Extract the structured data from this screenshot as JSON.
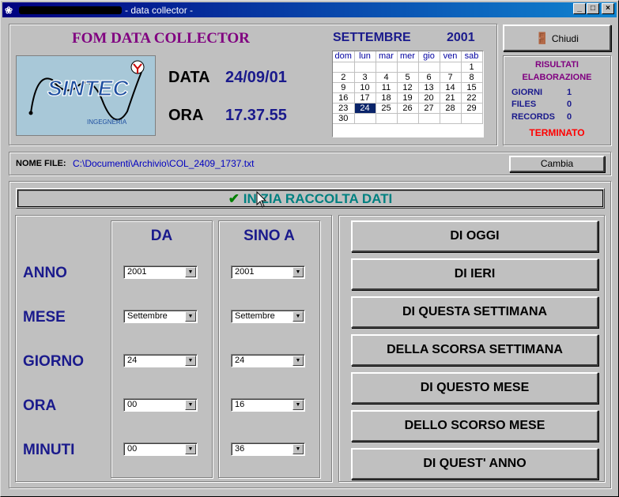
{
  "window": {
    "app_name_obscured": true,
    "title": "- data collector -"
  },
  "header": {
    "app_title": "FOM DATA COLLECTOR",
    "data_label": "DATA",
    "data_value": "24/09/01",
    "ora_label": "ORA",
    "ora_value": "17.37.55"
  },
  "logo": {
    "brand": "SINTEC",
    "subtitle": "INGEGNERIA"
  },
  "calendar": {
    "month": "SETTEMBRE",
    "year": "2001",
    "weekdays": [
      "dom",
      "lun",
      "mar",
      "mer",
      "gio",
      "ven",
      "sab"
    ],
    "weeks": [
      [
        "",
        "",
        "",
        "",
        "",
        "",
        "1"
      ],
      [
        "2",
        "3",
        "4",
        "5",
        "6",
        "7",
        "8"
      ],
      [
        "9",
        "10",
        "11",
        "12",
        "13",
        "14",
        "15"
      ],
      [
        "16",
        "17",
        "18",
        "19",
        "20",
        "21",
        "22"
      ],
      [
        "23",
        "24",
        "25",
        "26",
        "27",
        "28",
        "29"
      ],
      [
        "30",
        "",
        "",
        "",
        "",
        "",
        ""
      ]
    ],
    "selected_day": "24"
  },
  "close_button": {
    "label": "Chiudi"
  },
  "results": {
    "heading1": "RISULTATI",
    "heading2": "ELABORAZIONE",
    "giorni_label": "GIORNI",
    "giorni_value": "1",
    "files_label": "FILES",
    "files_value": "0",
    "records_label": "RECORDS",
    "records_value": "0",
    "status": "TERMINATO"
  },
  "file": {
    "label": "NOME FILE:",
    "path": "C:\\Documenti\\Archivio\\COL_2409_1737.txt",
    "change_button": "Cambia"
  },
  "start_button": {
    "label": "INIZIA RACCOLTA DATI"
  },
  "range": {
    "from_header": "DA",
    "to_header": "SINO A",
    "rows": [
      {
        "label": "ANNO",
        "from": "2001",
        "to": "2001"
      },
      {
        "label": "MESE",
        "from": "Settembre",
        "to": "Settembre"
      },
      {
        "label": "GIORNO",
        "from": "24",
        "to": "24"
      },
      {
        "label": "ORA",
        "from": "00",
        "to": "16"
      },
      {
        "label": "MINUTI",
        "from": "00",
        "to": "36"
      }
    ]
  },
  "presets": [
    "DI OGGI",
    "DI IERI",
    "DI QUESTA SETTIMANA",
    "DELLA SCORSA SETTIMANA",
    "DI QUESTO MESE",
    "DELLO SCORSO MESE",
    "DI QUEST' ANNO"
  ],
  "colors": {
    "title_purple": "#800080",
    "value_blue": "#1a1a8c",
    "status_red": "#ff0000",
    "start_teal": "#008080",
    "check_green": "#008000",
    "path_blue": "#0000c0"
  }
}
